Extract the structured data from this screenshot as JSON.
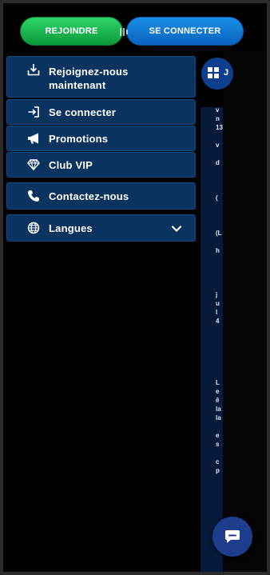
{
  "header": {
    "join_label": "REJOINDRE",
    "login_label": "SE CONNECTER"
  },
  "menu": {
    "items": [
      {
        "label": "Rejoignez-nous maintenant",
        "icon": "download-icon"
      },
      {
        "label": "Se connecter",
        "icon": "login-icon"
      },
      {
        "label": "Promotions",
        "icon": "megaphone-icon"
      },
      {
        "label": "Club VIP",
        "icon": "diamond-icon"
      },
      {
        "label": "Contactez-nous",
        "icon": "phone-icon"
      },
      {
        "label": "Langues",
        "icon": "globe-icon"
      }
    ]
  },
  "background_peek": {
    "chip_text": "J",
    "lines": [
      "v",
      "n",
      "13",
      "",
      "v",
      "",
      "d",
      "",
      "",
      "",
      "(",
      "",
      "",
      "",
      "(L",
      "",
      "h",
      "",
      "",
      "",
      "",
      "j",
      "u",
      "l",
      "4",
      "",
      "",
      "",
      "",
      "",
      "",
      "L",
      "e",
      "ê",
      "la",
      "la",
      "",
      "e",
      "s",
      "",
      "c",
      "p"
    ]
  },
  "colors": {
    "join_green": "#0a9a3b",
    "login_blue": "#0a63c0",
    "menu_bg": "#0a335f",
    "chat_blue": "#1e3d8a"
  }
}
